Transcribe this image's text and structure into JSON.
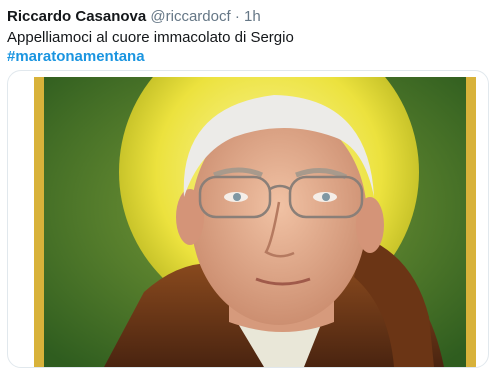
{
  "tweet": {
    "author_name": "Riccardo Casanova",
    "author_handle": "@riccardocf",
    "separator": "·",
    "time": "1h",
    "text": "Appelliamoci al cuore immacolato di Sergio",
    "hashtag": "#maratonamentana"
  },
  "media": {
    "description": "photo-portrait"
  },
  "colors": {
    "text_primary": "#14171a",
    "text_secondary": "#657786",
    "link": "#1b95e0",
    "card_border": "#e1e8ed",
    "image_background": "#3f6d2a",
    "halo": "#e8e23c",
    "frame_gold": "#d8b23a"
  }
}
